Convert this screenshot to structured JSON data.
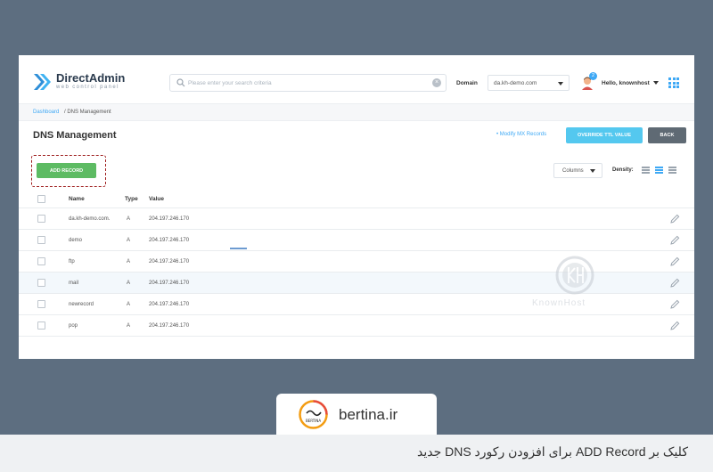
{
  "header": {
    "brand": "DirectAdmin",
    "tagline": "web control panel",
    "search_placeholder": "Please enter your search criteria",
    "domain_label": "Domain",
    "domain_value": "da.kh-demo.com",
    "notification_count": "2",
    "user_greeting": "Hello, knownhost"
  },
  "breadcrumb": {
    "home": "Dashboard",
    "current": "/ DNS Management"
  },
  "page": {
    "title": "DNS Management",
    "modify_mx_link": "• Modify MX Records",
    "override_ttl_label": "OVERRIDE TTL VALUE",
    "back_label": "BACK",
    "add_record_label": "ADD RECORD",
    "columns_label": "Columns",
    "density_label": "Density:"
  },
  "table": {
    "headers": {
      "name": "Name",
      "type": "Type",
      "value": "Value"
    },
    "rows": [
      {
        "name": "da.kh-demo.com.",
        "type": "A",
        "value": "204.197.246.170"
      },
      {
        "name": "demo",
        "type": "A",
        "value": "204.197.246.170"
      },
      {
        "name": "ftp",
        "type": "A",
        "value": "204.197.246.170"
      },
      {
        "name": "mail",
        "type": "A",
        "value": "204.197.246.170"
      },
      {
        "name": "newrecord",
        "type": "A",
        "value": "204.197.246.170"
      },
      {
        "name": "pop",
        "type": "A",
        "value": "204.197.246.170"
      }
    ]
  },
  "watermark": {
    "text": "KnownHost"
  },
  "footer": {
    "site": "bertina.ir",
    "logo_text": "BERTINA",
    "caption": "کلیک بر ADD Record برای افزودن رکورد DNS جدید"
  },
  "colors": {
    "accent": "#3fa9f5",
    "add_button": "#5dbb63",
    "ttl_button": "#54c8ef",
    "back_button": "#5f6a74",
    "highlight_border": "#9e1c1c",
    "row_hover": "#f3f8fc",
    "background": "#5d6e80"
  },
  "icons": {
    "logo": "directadmin-chevrons-icon",
    "search": "search-icon",
    "clear": "clear-icon",
    "avatar": "user-avatar-icon",
    "apps": "grid-apps-icon",
    "edit": "pencil-icon"
  }
}
